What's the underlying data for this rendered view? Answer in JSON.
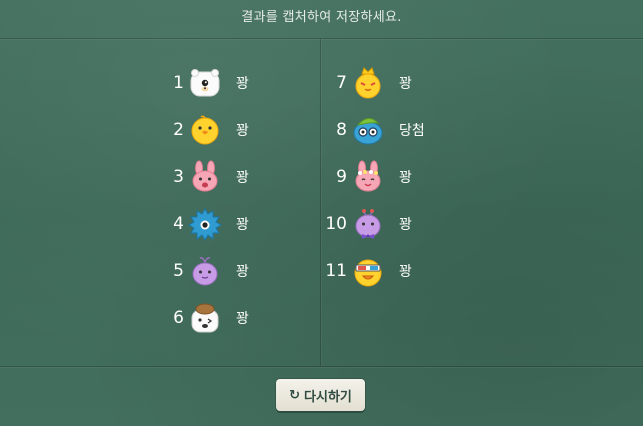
{
  "header": {
    "title": "결과를 캡처하여 저장하세요."
  },
  "results_left": [
    {
      "number": "1",
      "character_icon": "white-bear-icon",
      "result": "꽝"
    },
    {
      "number": "2",
      "character_icon": "yellow-chick-icon",
      "result": "꽝"
    },
    {
      "number": "3",
      "character_icon": "pink-rabbit-icon",
      "result": "꽝"
    },
    {
      "number": "4",
      "character_icon": "blue-hedgehog-icon",
      "result": "꽝"
    },
    {
      "number": "5",
      "character_icon": "purple-whale-icon",
      "result": "꽝"
    },
    {
      "number": "6",
      "character_icon": "white-dog-with-hat-icon",
      "result": "꽝"
    }
  ],
  "results_right": [
    {
      "number": "7",
      "character_icon": "crowned-chick-icon",
      "result": "꽝"
    },
    {
      "number": "8",
      "character_icon": "blue-character-with-glasses-icon",
      "result": "당첨"
    },
    {
      "number": "9",
      "character_icon": "rabbit-with-flower-crown-icon",
      "result": "꽝"
    },
    {
      "number": "10",
      "character_icon": "purple-bowtie-character-icon",
      "result": "꽝"
    },
    {
      "number": "11",
      "character_icon": "chick-with-3d-glasses-icon",
      "result": "꽝"
    }
  ],
  "retry_button": {
    "icon": "refresh-icon",
    "label": "다시하기"
  },
  "colors": {
    "board": "#3f6a59",
    "text": "#ffffff",
    "button": "#eeebe2"
  }
}
